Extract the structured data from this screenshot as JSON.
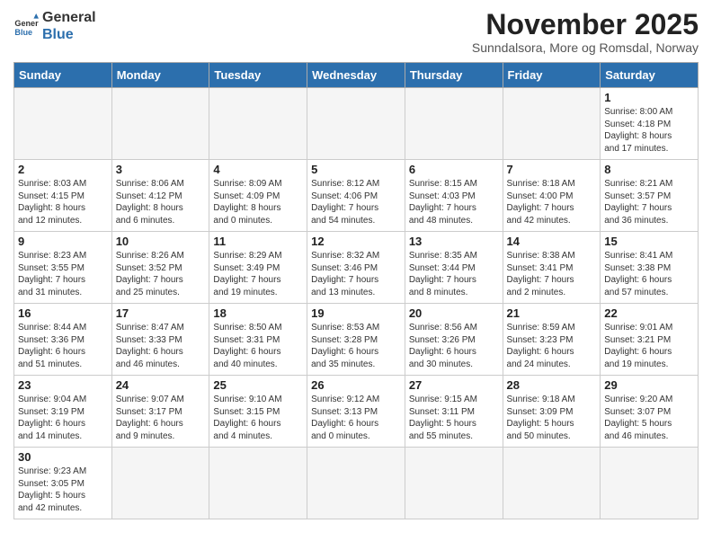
{
  "header": {
    "logo_general": "General",
    "logo_blue": "Blue",
    "month_title": "November 2025",
    "subtitle": "Sunndalsora, More og Romsdal, Norway"
  },
  "days_of_week": [
    "Sunday",
    "Monday",
    "Tuesday",
    "Wednesday",
    "Thursday",
    "Friday",
    "Saturday"
  ],
  "weeks": [
    [
      {
        "day": "",
        "content": ""
      },
      {
        "day": "",
        "content": ""
      },
      {
        "day": "",
        "content": ""
      },
      {
        "day": "",
        "content": ""
      },
      {
        "day": "",
        "content": ""
      },
      {
        "day": "",
        "content": ""
      },
      {
        "day": "1",
        "content": "Sunrise: 8:00 AM\nSunset: 4:18 PM\nDaylight: 8 hours\nand 17 minutes."
      }
    ],
    [
      {
        "day": "2",
        "content": "Sunrise: 8:03 AM\nSunset: 4:15 PM\nDaylight: 8 hours\nand 12 minutes."
      },
      {
        "day": "3",
        "content": "Sunrise: 8:06 AM\nSunset: 4:12 PM\nDaylight: 8 hours\nand 6 minutes."
      },
      {
        "day": "4",
        "content": "Sunrise: 8:09 AM\nSunset: 4:09 PM\nDaylight: 8 hours\nand 0 minutes."
      },
      {
        "day": "5",
        "content": "Sunrise: 8:12 AM\nSunset: 4:06 PM\nDaylight: 7 hours\nand 54 minutes."
      },
      {
        "day": "6",
        "content": "Sunrise: 8:15 AM\nSunset: 4:03 PM\nDaylight: 7 hours\nand 48 minutes."
      },
      {
        "day": "7",
        "content": "Sunrise: 8:18 AM\nSunset: 4:00 PM\nDaylight: 7 hours\nand 42 minutes."
      },
      {
        "day": "8",
        "content": "Sunrise: 8:21 AM\nSunset: 3:57 PM\nDaylight: 7 hours\nand 36 minutes."
      }
    ],
    [
      {
        "day": "9",
        "content": "Sunrise: 8:23 AM\nSunset: 3:55 PM\nDaylight: 7 hours\nand 31 minutes."
      },
      {
        "day": "10",
        "content": "Sunrise: 8:26 AM\nSunset: 3:52 PM\nDaylight: 7 hours\nand 25 minutes."
      },
      {
        "day": "11",
        "content": "Sunrise: 8:29 AM\nSunset: 3:49 PM\nDaylight: 7 hours\nand 19 minutes."
      },
      {
        "day": "12",
        "content": "Sunrise: 8:32 AM\nSunset: 3:46 PM\nDaylight: 7 hours\nand 13 minutes."
      },
      {
        "day": "13",
        "content": "Sunrise: 8:35 AM\nSunset: 3:44 PM\nDaylight: 7 hours\nand 8 minutes."
      },
      {
        "day": "14",
        "content": "Sunrise: 8:38 AM\nSunset: 3:41 PM\nDaylight: 7 hours\nand 2 minutes."
      },
      {
        "day": "15",
        "content": "Sunrise: 8:41 AM\nSunset: 3:38 PM\nDaylight: 6 hours\nand 57 minutes."
      }
    ],
    [
      {
        "day": "16",
        "content": "Sunrise: 8:44 AM\nSunset: 3:36 PM\nDaylight: 6 hours\nand 51 minutes."
      },
      {
        "day": "17",
        "content": "Sunrise: 8:47 AM\nSunset: 3:33 PM\nDaylight: 6 hours\nand 46 minutes."
      },
      {
        "day": "18",
        "content": "Sunrise: 8:50 AM\nSunset: 3:31 PM\nDaylight: 6 hours\nand 40 minutes."
      },
      {
        "day": "19",
        "content": "Sunrise: 8:53 AM\nSunset: 3:28 PM\nDaylight: 6 hours\nand 35 minutes."
      },
      {
        "day": "20",
        "content": "Sunrise: 8:56 AM\nSunset: 3:26 PM\nDaylight: 6 hours\nand 30 minutes."
      },
      {
        "day": "21",
        "content": "Sunrise: 8:59 AM\nSunset: 3:23 PM\nDaylight: 6 hours\nand 24 minutes."
      },
      {
        "day": "22",
        "content": "Sunrise: 9:01 AM\nSunset: 3:21 PM\nDaylight: 6 hours\nand 19 minutes."
      }
    ],
    [
      {
        "day": "23",
        "content": "Sunrise: 9:04 AM\nSunset: 3:19 PM\nDaylight: 6 hours\nand 14 minutes."
      },
      {
        "day": "24",
        "content": "Sunrise: 9:07 AM\nSunset: 3:17 PM\nDaylight: 6 hours\nand 9 minutes."
      },
      {
        "day": "25",
        "content": "Sunrise: 9:10 AM\nSunset: 3:15 PM\nDaylight: 6 hours\nand 4 minutes."
      },
      {
        "day": "26",
        "content": "Sunrise: 9:12 AM\nSunset: 3:13 PM\nDaylight: 6 hours\nand 0 minutes."
      },
      {
        "day": "27",
        "content": "Sunrise: 9:15 AM\nSunset: 3:11 PM\nDaylight: 5 hours\nand 55 minutes."
      },
      {
        "day": "28",
        "content": "Sunrise: 9:18 AM\nSunset: 3:09 PM\nDaylight: 5 hours\nand 50 minutes."
      },
      {
        "day": "29",
        "content": "Sunrise: 9:20 AM\nSunset: 3:07 PM\nDaylight: 5 hours\nand 46 minutes."
      }
    ],
    [
      {
        "day": "30",
        "content": "Sunrise: 9:23 AM\nSunset: 3:05 PM\nDaylight: 5 hours\nand 42 minutes."
      },
      {
        "day": "",
        "content": ""
      },
      {
        "day": "",
        "content": ""
      },
      {
        "day": "",
        "content": ""
      },
      {
        "day": "",
        "content": ""
      },
      {
        "day": "",
        "content": ""
      },
      {
        "day": "",
        "content": ""
      }
    ]
  ]
}
